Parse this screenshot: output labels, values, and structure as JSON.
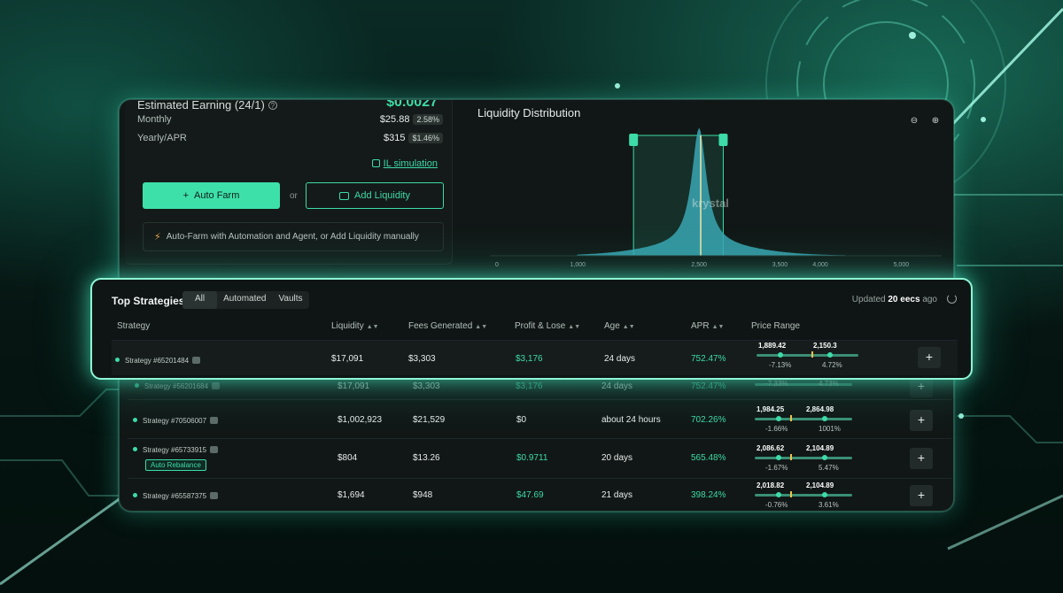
{
  "earning": {
    "title": "Estimated Earning (24/1)",
    "help_icon": "question-icon",
    "amount": "$0.0027",
    "monthly_label": "Monthly",
    "monthly_value": "$25.88",
    "monthly_pct": "2.58%",
    "yearly_label": "Yearly/APR",
    "yearly_value": "$315",
    "yearly_pct": "$1.46%",
    "il_link": "IL simulation",
    "auto_farm_label": "Auto Farm",
    "or_label": "or",
    "add_liquidity_label": "Add Liquidity",
    "notice": "Auto-Farm with Automation and Agent, or Add Liquidity manually"
  },
  "chart": {
    "title": "Liquidity Distribution",
    "watermark": "krystal",
    "zoom_out_icon": "zoom-out-icon",
    "zoom_in_icon": "zoom-in-icon"
  },
  "chart_data": {
    "type": "area",
    "title": "Liquidity Distribution",
    "xlabel": "",
    "ylabel": "",
    "xlim": [
      0,
      5500
    ],
    "x_ticks": [
      "0",
      "1,000",
      "2,500",
      "3,500",
      "4,000",
      "5,000"
    ],
    "selected_range": [
      1689,
      2799
    ],
    "current_price": 2520,
    "peak_x": 2500,
    "grid": false
  },
  "strategies": {
    "title": "Top Strategies",
    "filters": [
      "All",
      "Automated",
      "Vaults"
    ],
    "updated_prefix": "Updated",
    "updated_value": "20 eecs",
    "updated_suffix": "ago",
    "columns": [
      "Strategy",
      "Liquidity",
      "Fees Generated",
      "Profit & Lose",
      "Age",
      "APR",
      "Price Range"
    ],
    "highlight": {
      "name": "Strategy #65201484",
      "liquidity": "$17,091",
      "fees": "$3,303",
      "profit": "$3,176",
      "age": "24 days",
      "apr": "752.47%",
      "range_low": "1,889.42",
      "range_high": "2,150.3",
      "pct_low": "-7.13%",
      "pct_high": "4.72%"
    },
    "rows": [
      {
        "name": "Strategy #56201684",
        "liquidity": "$17,091",
        "fees": "$3,303",
        "profit": "$3,176",
        "age": "24 days",
        "apr": "752.47%",
        "range_low": "",
        "range_high": "",
        "pct_low": "-7.33%",
        "pct_high": "4.73%"
      },
      {
        "name": "Strategy #70506007",
        "liquidity": "$1,002,923",
        "fees": "$21,529",
        "profit": "$0",
        "age": "about 24 hours",
        "apr": "702.26%",
        "range_low": "1,984.25",
        "range_high": "2,864.98",
        "pct_low": "-1.66%",
        "pct_high": "1001%"
      },
      {
        "name": "Strategy #65733915",
        "tag": "Auto Rebalance",
        "liquidity": "$804",
        "fees": "$13.26",
        "profit": "$0.9711",
        "age": "20 days",
        "apr": "565.48%",
        "range_low": "2,086.62",
        "range_high": "2,104.89",
        "pct_low": "-1.67%",
        "pct_high": "5.47%"
      },
      {
        "name": "Strategy #65587375",
        "liquidity": "$1,694",
        "fees": "$948",
        "profit": "$47.69",
        "age": "21 days",
        "apr": "398.24%",
        "range_low": "2,018.82",
        "range_high": "2,104.89",
        "pct_low": "-0.76%",
        "pct_high": "3.61%"
      }
    ]
  }
}
